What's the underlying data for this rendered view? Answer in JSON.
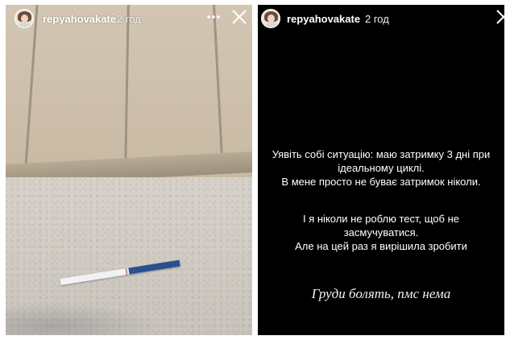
{
  "left_story": {
    "username": "repyahovakate",
    "time": "2 год",
    "more_icon": "more-horizontal-icon",
    "close_icon": "close-icon"
  },
  "right_story": {
    "username": "repyahovakate",
    "time": "2 год",
    "close_icon": "close-icon",
    "paragraph1_line1": "Уявіть собі ситуацію: маю затримку 3 дні при",
    "paragraph1_line2": "ідеальному циклі.",
    "paragraph1_line3": "В мене просто не буває затримок ніколи.",
    "paragraph2_line1": "І я ніколи не роблю тест, щоб не",
    "paragraph2_line2": "засмучуватися.",
    "paragraph2_line3": "Але на цей раз я вирішила зробити",
    "paragraph3": "Груди болять, пмс нема"
  },
  "colors": {
    "right_background": "#000000",
    "text": "#ffffff",
    "test_strip_blue": "#2c4f8e"
  }
}
